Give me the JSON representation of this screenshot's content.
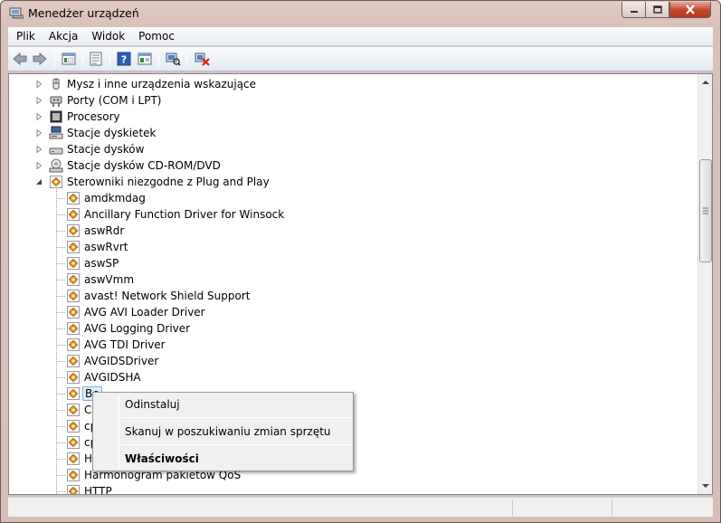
{
  "window": {
    "title": "Menedżer urządzeń"
  },
  "menubar": {
    "items": [
      "Plik",
      "Akcja",
      "Widok",
      "Pomoc"
    ]
  },
  "toolbar": {
    "buttons": [
      "back-icon",
      "forward-icon",
      "show-hide-console-tree-icon",
      "properties-icon",
      "help-icon",
      "view-icon",
      "scan-hardware-icon",
      "uninstall-icon"
    ]
  },
  "tree": {
    "categories": [
      {
        "label": "Mysz i inne urządzenia wskazujące",
        "icon": "mouse-icon",
        "expanded": false
      },
      {
        "label": "Porty (COM i LPT)",
        "icon": "port-icon",
        "expanded": false
      },
      {
        "label": "Procesory",
        "icon": "processor-icon",
        "expanded": false
      },
      {
        "label": "Stacje dyskietek",
        "icon": "floppy-icon",
        "expanded": false
      },
      {
        "label": "Stacje dysków",
        "icon": "disk-icon",
        "expanded": false
      },
      {
        "label": "Stacje dysków CD-ROM/DVD",
        "icon": "cdrom-icon",
        "expanded": false
      },
      {
        "label": "Sterowniki niezgodne z Plug and Play",
        "icon": "driver-icon",
        "expanded": true
      }
    ],
    "drivers": [
      "amdkmdag",
      "Ancillary Function Driver for Winsock",
      "aswRdr",
      "aswRvrt",
      "aswSP",
      "aswVmm",
      "avast! Network Shield Support",
      "AVG AVI Loader Driver",
      "AVG Logging Driver",
      "AVG TDI Driver",
      "AVGIDSDriver",
      "AVGIDSHA",
      "Be",
      "CN",
      "cp",
      "cp",
      "Ha",
      "Harmonogram pakietów QoS",
      "HTTP"
    ],
    "selected_index": 12
  },
  "context_menu": {
    "uninstall": "Odinstaluj",
    "scan": "Skanuj w poszukiwaniu zmian sprzętu",
    "properties": "Właściwości"
  }
}
